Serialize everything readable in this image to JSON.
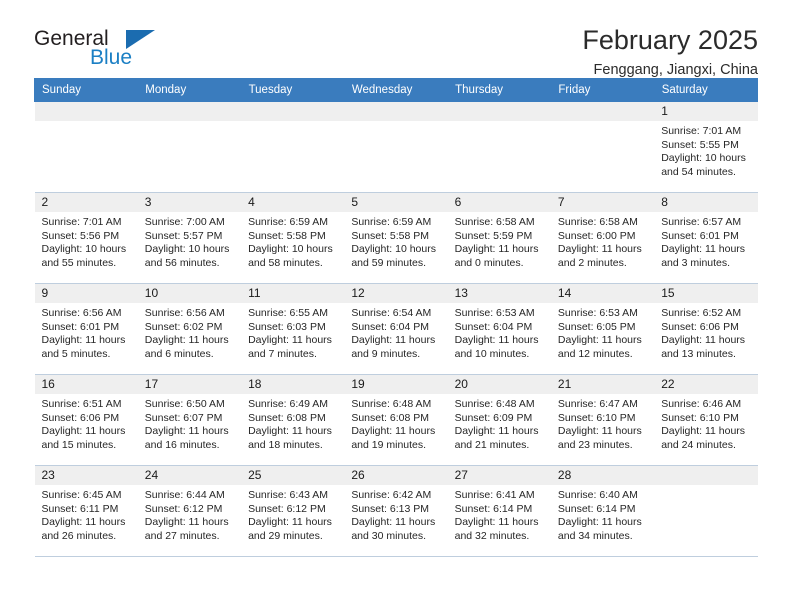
{
  "brand": {
    "name_part1": "General",
    "name_part2": "Blue",
    "triangle_icon": "triangle-icon",
    "accent_color": "#1b7fc4"
  },
  "header": {
    "title": "February 2025",
    "subtitle": "Fenggang, Jiangxi, China"
  },
  "calendar": {
    "header_bg": "#3a7cbe",
    "daynum_bg": "#efefef",
    "weekday_headers": [
      "Sunday",
      "Monday",
      "Tuesday",
      "Wednesday",
      "Thursday",
      "Friday",
      "Saturday"
    ],
    "weeks": [
      [
        {
          "empty": true
        },
        {
          "empty": true
        },
        {
          "empty": true
        },
        {
          "empty": true
        },
        {
          "empty": true
        },
        {
          "empty": true
        },
        {
          "day": "1",
          "sunrise": "Sunrise: 7:01 AM",
          "sunset": "Sunset: 5:55 PM",
          "daylight": "Daylight: 10 hours and 54 minutes."
        }
      ],
      [
        {
          "day": "2",
          "sunrise": "Sunrise: 7:01 AM",
          "sunset": "Sunset: 5:56 PM",
          "daylight": "Daylight: 10 hours and 55 minutes."
        },
        {
          "day": "3",
          "sunrise": "Sunrise: 7:00 AM",
          "sunset": "Sunset: 5:57 PM",
          "daylight": "Daylight: 10 hours and 56 minutes."
        },
        {
          "day": "4",
          "sunrise": "Sunrise: 6:59 AM",
          "sunset": "Sunset: 5:58 PM",
          "daylight": "Daylight: 10 hours and 58 minutes."
        },
        {
          "day": "5",
          "sunrise": "Sunrise: 6:59 AM",
          "sunset": "Sunset: 5:58 PM",
          "daylight": "Daylight: 10 hours and 59 minutes."
        },
        {
          "day": "6",
          "sunrise": "Sunrise: 6:58 AM",
          "sunset": "Sunset: 5:59 PM",
          "daylight": "Daylight: 11 hours and 0 minutes."
        },
        {
          "day": "7",
          "sunrise": "Sunrise: 6:58 AM",
          "sunset": "Sunset: 6:00 PM",
          "daylight": "Daylight: 11 hours and 2 minutes."
        },
        {
          "day": "8",
          "sunrise": "Sunrise: 6:57 AM",
          "sunset": "Sunset: 6:01 PM",
          "daylight": "Daylight: 11 hours and 3 minutes."
        }
      ],
      [
        {
          "day": "9",
          "sunrise": "Sunrise: 6:56 AM",
          "sunset": "Sunset: 6:01 PM",
          "daylight": "Daylight: 11 hours and 5 minutes."
        },
        {
          "day": "10",
          "sunrise": "Sunrise: 6:56 AM",
          "sunset": "Sunset: 6:02 PM",
          "daylight": "Daylight: 11 hours and 6 minutes."
        },
        {
          "day": "11",
          "sunrise": "Sunrise: 6:55 AM",
          "sunset": "Sunset: 6:03 PM",
          "daylight": "Daylight: 11 hours and 7 minutes."
        },
        {
          "day": "12",
          "sunrise": "Sunrise: 6:54 AM",
          "sunset": "Sunset: 6:04 PM",
          "daylight": "Daylight: 11 hours and 9 minutes."
        },
        {
          "day": "13",
          "sunrise": "Sunrise: 6:53 AM",
          "sunset": "Sunset: 6:04 PM",
          "daylight": "Daylight: 11 hours and 10 minutes."
        },
        {
          "day": "14",
          "sunrise": "Sunrise: 6:53 AM",
          "sunset": "Sunset: 6:05 PM",
          "daylight": "Daylight: 11 hours and 12 minutes."
        },
        {
          "day": "15",
          "sunrise": "Sunrise: 6:52 AM",
          "sunset": "Sunset: 6:06 PM",
          "daylight": "Daylight: 11 hours and 13 minutes."
        }
      ],
      [
        {
          "day": "16",
          "sunrise": "Sunrise: 6:51 AM",
          "sunset": "Sunset: 6:06 PM",
          "daylight": "Daylight: 11 hours and 15 minutes."
        },
        {
          "day": "17",
          "sunrise": "Sunrise: 6:50 AM",
          "sunset": "Sunset: 6:07 PM",
          "daylight": "Daylight: 11 hours and 16 minutes."
        },
        {
          "day": "18",
          "sunrise": "Sunrise: 6:49 AM",
          "sunset": "Sunset: 6:08 PM",
          "daylight": "Daylight: 11 hours and 18 minutes."
        },
        {
          "day": "19",
          "sunrise": "Sunrise: 6:48 AM",
          "sunset": "Sunset: 6:08 PM",
          "daylight": "Daylight: 11 hours and 19 minutes."
        },
        {
          "day": "20",
          "sunrise": "Sunrise: 6:48 AM",
          "sunset": "Sunset: 6:09 PM",
          "daylight": "Daylight: 11 hours and 21 minutes."
        },
        {
          "day": "21",
          "sunrise": "Sunrise: 6:47 AM",
          "sunset": "Sunset: 6:10 PM",
          "daylight": "Daylight: 11 hours and 23 minutes."
        },
        {
          "day": "22",
          "sunrise": "Sunrise: 6:46 AM",
          "sunset": "Sunset: 6:10 PM",
          "daylight": "Daylight: 11 hours and 24 minutes."
        }
      ],
      [
        {
          "day": "23",
          "sunrise": "Sunrise: 6:45 AM",
          "sunset": "Sunset: 6:11 PM",
          "daylight": "Daylight: 11 hours and 26 minutes."
        },
        {
          "day": "24",
          "sunrise": "Sunrise: 6:44 AM",
          "sunset": "Sunset: 6:12 PM",
          "daylight": "Daylight: 11 hours and 27 minutes."
        },
        {
          "day": "25",
          "sunrise": "Sunrise: 6:43 AM",
          "sunset": "Sunset: 6:12 PM",
          "daylight": "Daylight: 11 hours and 29 minutes."
        },
        {
          "day": "26",
          "sunrise": "Sunrise: 6:42 AM",
          "sunset": "Sunset: 6:13 PM",
          "daylight": "Daylight: 11 hours and 30 minutes."
        },
        {
          "day": "27",
          "sunrise": "Sunrise: 6:41 AM",
          "sunset": "Sunset: 6:14 PM",
          "daylight": "Daylight: 11 hours and 32 minutes."
        },
        {
          "day": "28",
          "sunrise": "Sunrise: 6:40 AM",
          "sunset": "Sunset: 6:14 PM",
          "daylight": "Daylight: 11 hours and 34 minutes."
        },
        {
          "empty": true
        }
      ]
    ]
  }
}
